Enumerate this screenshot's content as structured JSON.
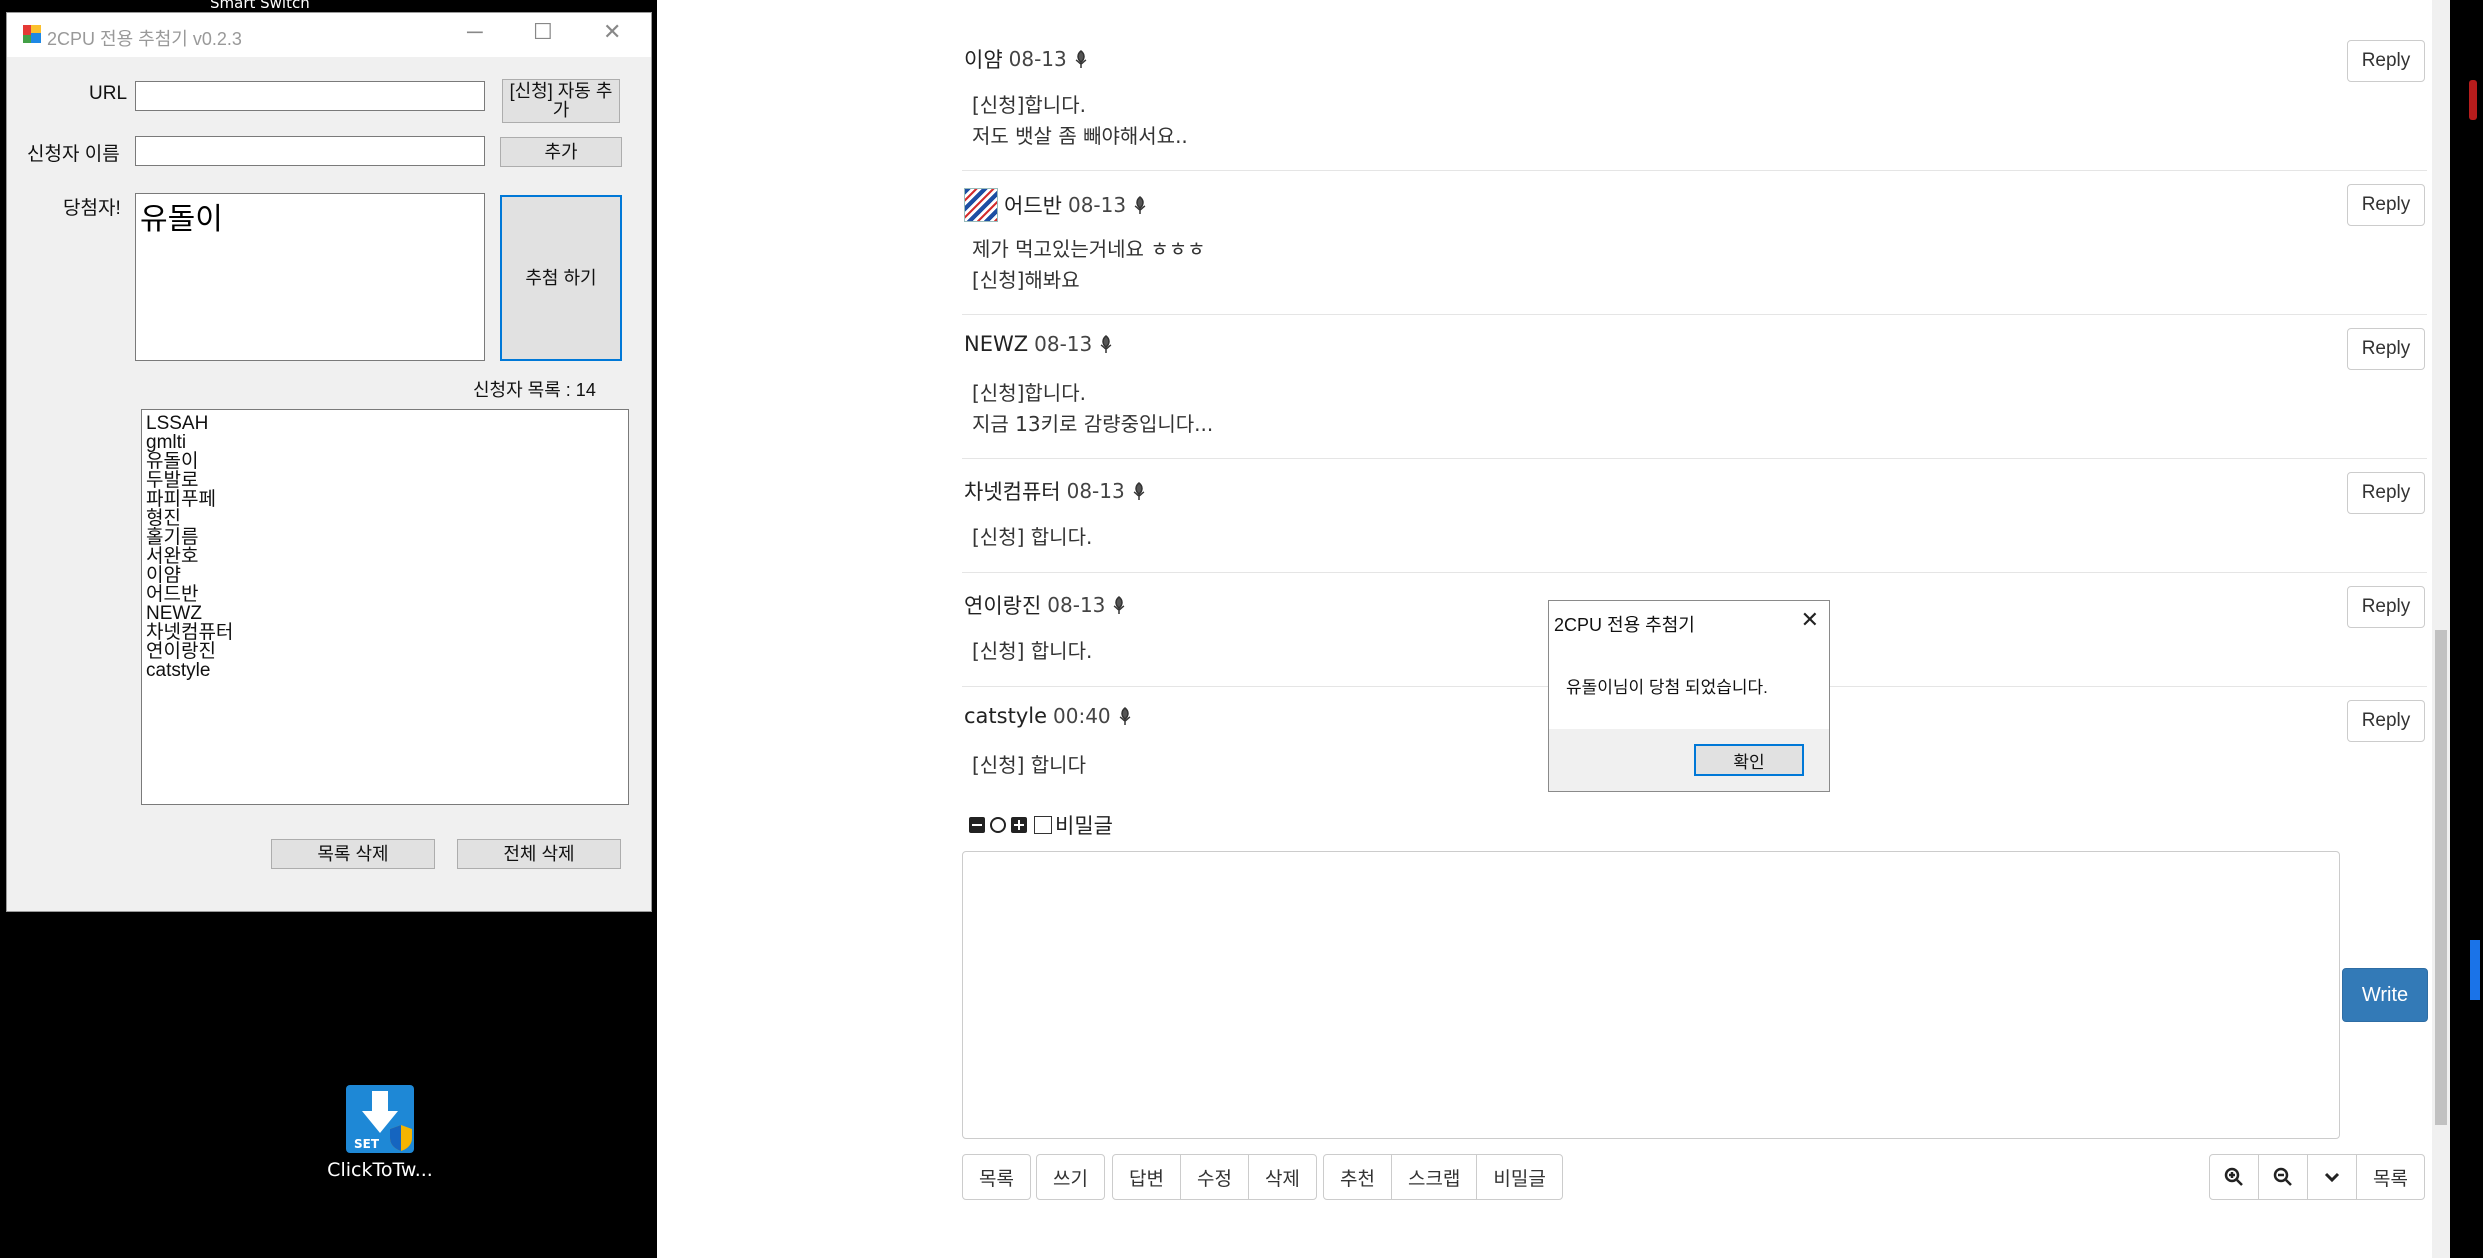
{
  "desktop": {
    "top_label": "Smart Switch",
    "icon_label": "ClickToTw...",
    "icon_badge": "SET"
  },
  "comments": [
    {
      "author": "이얌",
      "date": "08-13",
      "lines": [
        "[신청]합니다.",
        "저도 뱃살 좀 빼야해서요.."
      ],
      "reply": "Reply"
    },
    {
      "author": "어드반",
      "date": "08-13",
      "lines": [
        "제가 먹고있는거네요 ㅎㅎㅎ",
        "[신청]해봐요"
      ],
      "reply": "Reply"
    },
    {
      "author": "NEWZ",
      "date": "08-13",
      "lines": [
        "[신청]합니다.",
        "지금 13키로 감량중입니다..."
      ],
      "reply": "Reply"
    },
    {
      "author": "차넷컴퓨터",
      "date": "08-13",
      "lines": [
        "[신청] 합니다."
      ],
      "reply": "Reply"
    },
    {
      "author": "연이랑진",
      "date": "08-13",
      "lines": [
        "[신청] 합니다."
      ],
      "reply": "Reply"
    },
    {
      "author": "catstyle",
      "date": "00:40",
      "lines": [
        "[신청] 합니다"
      ],
      "reply": "Reply"
    }
  ],
  "editor": {
    "secret_label": "비밀글",
    "write_label": "Write"
  },
  "bottom_buttons": {
    "list": "목록",
    "write": "쓰기",
    "group2": [
      "답변",
      "수정",
      "삭제"
    ],
    "group3": [
      "추천",
      "스크랩",
      "비밀글"
    ],
    "right_list": "목록"
  },
  "msgbox": {
    "title": "2CPU 전용 추첨기",
    "message": "유돌이님이 당첨 되었습니다.",
    "ok": "확인"
  },
  "app": {
    "title": "2CPU 전용 추첨기 v0.2.3",
    "url_label": "URL",
    "url_value": "",
    "auto_add_button": "[신청] 자동 추가",
    "name_label": "신청자 이름",
    "name_value": "",
    "add_button": "추가",
    "winner_label": "당첨자!",
    "winner_value": "유돌이",
    "draw_button": "추첨 하기",
    "count_label": "신청자 목록 : 14",
    "applicants": [
      "LSSAH",
      "gmlti",
      "유돌이",
      "두발로",
      "파피푸페",
      "형진",
      "홀기름",
      "서완호",
      "이얌",
      "어드반",
      "NEWZ",
      "차넷컴퓨터",
      "연이랑진",
      "catstyle"
    ],
    "delete_item_button": "목록 삭제",
    "delete_all_button": "전체 삭제"
  },
  "colors": {
    "write_button": "#337ab7",
    "focus_border": "#0078d7"
  }
}
